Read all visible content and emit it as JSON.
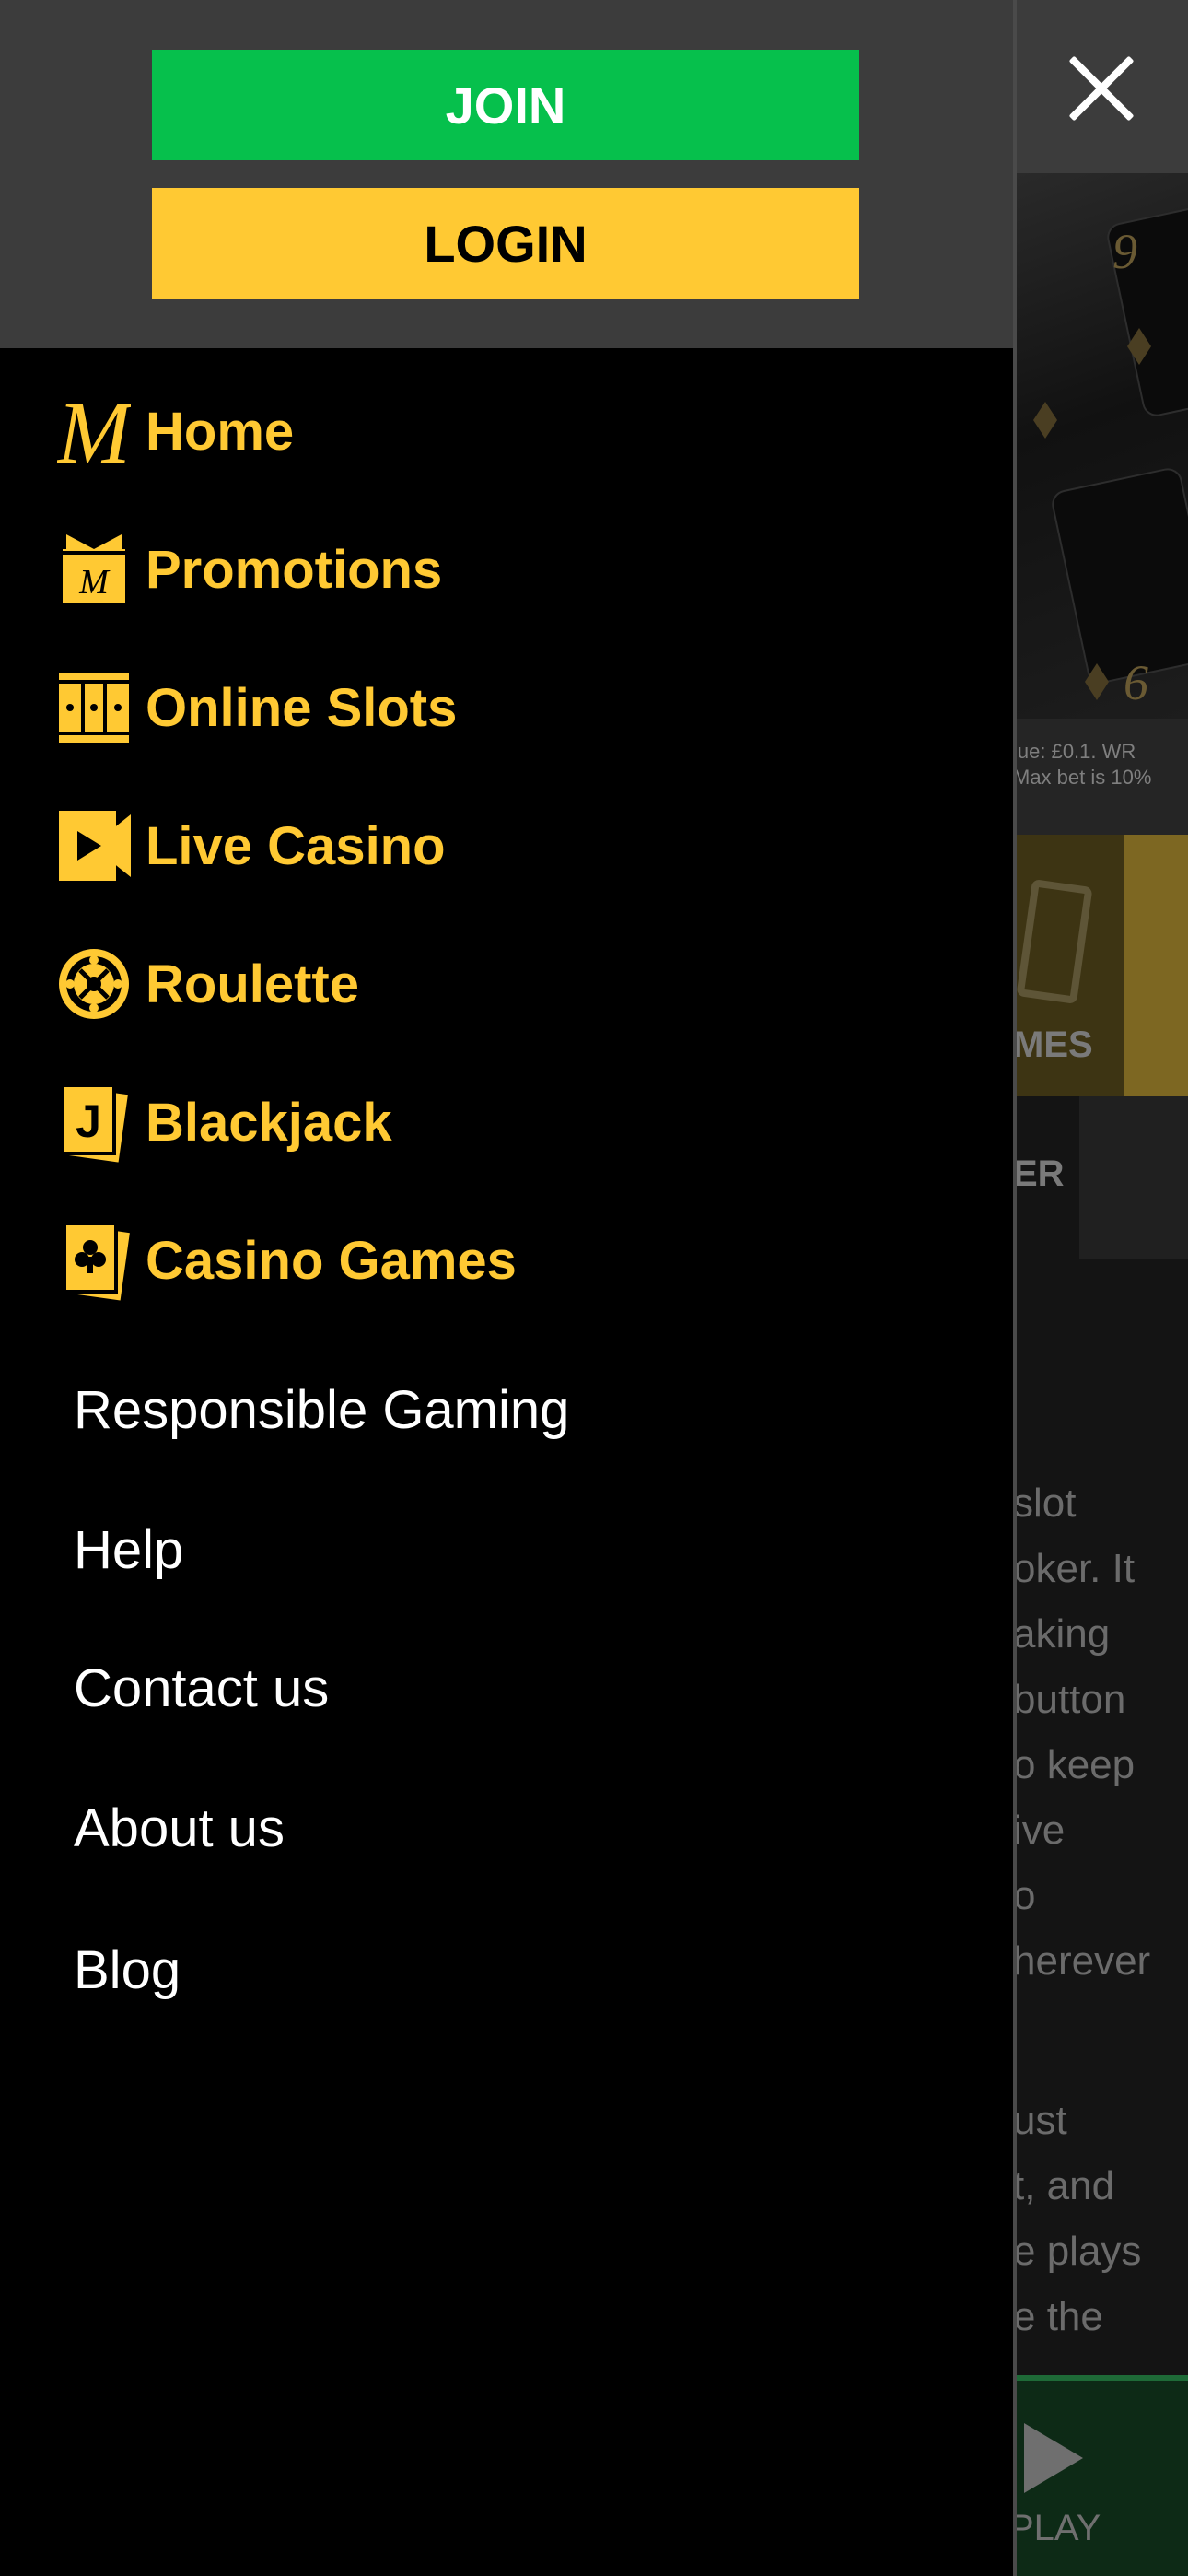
{
  "header": {
    "join_label": "JOIN",
    "login_label": "LOGIN",
    "close_icon": "close-icon"
  },
  "nav": [
    {
      "label": "Home",
      "icon": "brand-m-icon"
    },
    {
      "label": "Promotions",
      "icon": "gift-box-icon"
    },
    {
      "label": "Online Slots",
      "icon": "slot-machine-icon"
    },
    {
      "label": "Live Casino",
      "icon": "video-camera-icon"
    },
    {
      "label": "Roulette",
      "icon": "roulette-wheel-icon"
    },
    {
      "label": "Blackjack",
      "icon": "jack-card-icon"
    },
    {
      "label": "Casino Games",
      "icon": "club-card-icon"
    }
  ],
  "links": [
    "Responsible Gaming",
    "Help",
    "Contact us",
    "About us",
    "Blog"
  ],
  "background": {
    "hero_cards": [
      "9",
      "6"
    ],
    "hero_terms": "lue: £0.1. WR\nMax bet is 10%",
    "tile_label": "MES",
    "tab_label": "ER",
    "paragraph_1": "slot\noker. It\naking\nbutton\no keep\nive\no\nherever",
    "paragraph_2": "ust\nt, and\ne plays\ne the",
    "play_label": "PLAY"
  },
  "colors": {
    "accent_yellow": "#ffc933",
    "join_green": "#06c04c",
    "header_gray": "#3c3c3c",
    "drawer_black": "#000000"
  }
}
